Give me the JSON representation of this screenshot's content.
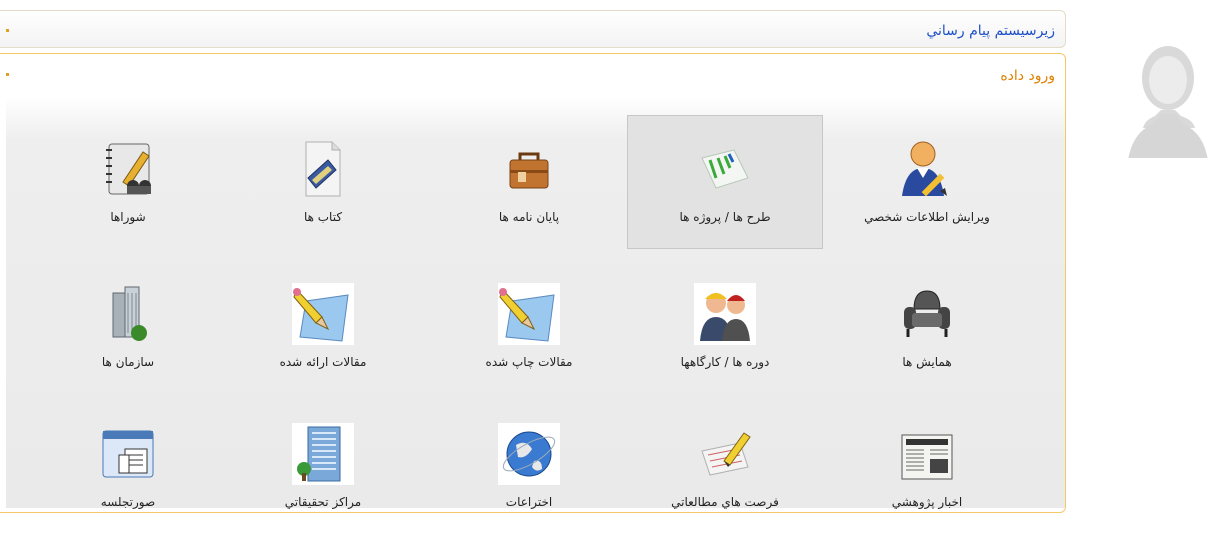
{
  "messaging_panel": {
    "title": "زيرسيستم پيام رساني"
  },
  "data_entry_panel": {
    "title": "ورود داده",
    "tiles": [
      {
        "label": "ويرايش اطلاعات شخصي",
        "icon": "edit-user-icon",
        "selected": false
      },
      {
        "label": "طرح ها / پروژه ها",
        "icon": "project-chart-icon",
        "selected": true
      },
      {
        "label": "پايان نامه ها",
        "icon": "briefcase-icon",
        "selected": false
      },
      {
        "label": "كتاب ها",
        "icon": "book-icon",
        "selected": false
      },
      {
        "label": "شوراها",
        "icon": "council-notebook-icon",
        "selected": false
      },
      {
        "label": "همايش ها",
        "icon": "armchair-icon",
        "selected": false
      },
      {
        "label": "دوره ها / كارگاهها",
        "icon": "workers-icon",
        "selected": false
      },
      {
        "label": "مقالات چاپ شده",
        "icon": "pencil-paper-icon",
        "selected": false
      },
      {
        "label": "مقالات ارائه شده",
        "icon": "pencil-paper-icon",
        "selected": false
      },
      {
        "label": "سازمان ها",
        "icon": "buildings-icon",
        "selected": false
      },
      {
        "label": "اخبار پژوهشي",
        "icon": "newspaper-icon",
        "selected": false
      },
      {
        "label": "فرصت هاي مطالعاتي",
        "icon": "study-pencil-icon",
        "selected": false
      },
      {
        "label": "اختراعات",
        "icon": "globe-icon",
        "selected": false
      },
      {
        "label": "مراكز تحقيقاتي",
        "icon": "office-tower-icon",
        "selected": false
      },
      {
        "label": "صورتجلسه",
        "icon": "minutes-window-icon",
        "selected": false
      }
    ]
  },
  "user": {
    "avatar": "avatar-silhouette-icon"
  }
}
